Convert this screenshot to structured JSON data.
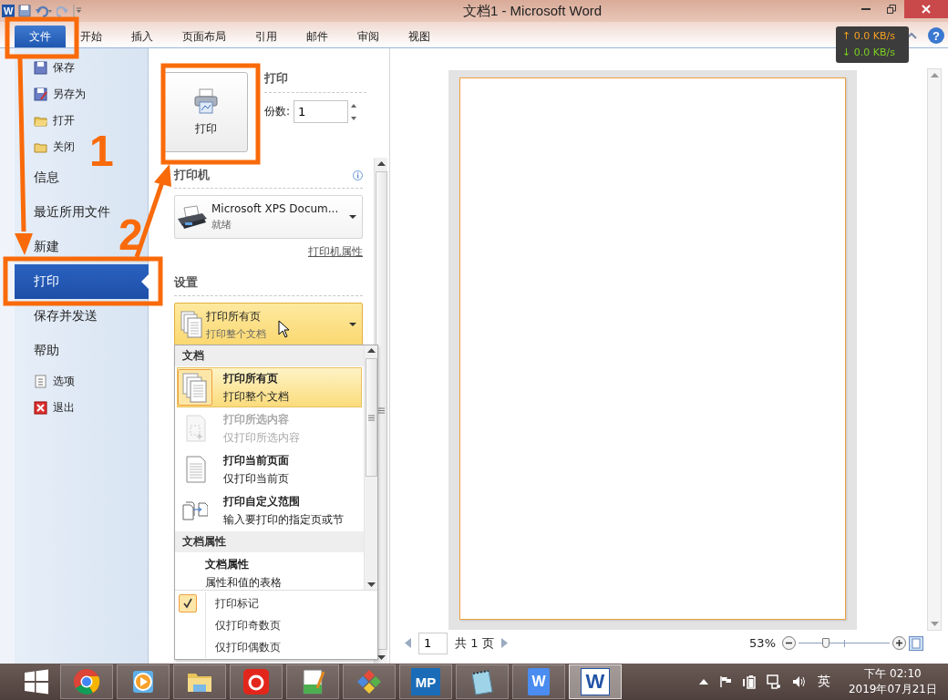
{
  "window": {
    "title": "文档1 - Microsoft Word",
    "app_logo": "W"
  },
  "ribbon_tabs": [
    {
      "label": "文件",
      "selected": true
    },
    {
      "label": "开始",
      "selected": false
    },
    {
      "label": "插入",
      "selected": false
    },
    {
      "label": "页面布局",
      "selected": false
    },
    {
      "label": "引用",
      "selected": false
    },
    {
      "label": "邮件",
      "selected": false
    },
    {
      "label": "审阅",
      "selected": false
    },
    {
      "label": "视图",
      "selected": false
    }
  ],
  "help_button": "?",
  "network_monitor": {
    "upload": "↑ 0.0 KB/s",
    "download": "↓ 0.0 KB/s"
  },
  "sidebar": {
    "items": [
      {
        "label": "保存",
        "kind": "small",
        "selected": false
      },
      {
        "label": "另存为",
        "kind": "small",
        "selected": false
      },
      {
        "label": "打开",
        "kind": "small",
        "selected": false
      },
      {
        "label": "关闭",
        "kind": "small",
        "selected": false
      },
      {
        "label": "信息",
        "kind": "large",
        "selected": false
      },
      {
        "label": "最近所用文件",
        "kind": "large",
        "selected": false
      },
      {
        "label": "新建",
        "kind": "large",
        "selected": false
      },
      {
        "label": "打印",
        "kind": "large",
        "selected": true
      },
      {
        "label": "保存并发送",
        "kind": "large",
        "selected": false
      },
      {
        "label": "帮助",
        "kind": "large",
        "selected": false
      },
      {
        "label": "选项",
        "kind": "small",
        "selected": false
      },
      {
        "label": "退出",
        "kind": "small",
        "selected": false
      }
    ]
  },
  "print_panel": {
    "print_button": "打印",
    "heading": "打印",
    "copies_label": "份数:",
    "copies_value": "1",
    "printer_heading": "打印机",
    "printer": {
      "name": "Microsoft XPS Docum...",
      "status": "就绪"
    },
    "printer_properties_link": "打印机属性",
    "settings_heading": "设置",
    "pages_dropdown": {
      "title": "打印所有页",
      "subtitle": "打印整个文档"
    }
  },
  "pages_menu": {
    "sections": [
      {
        "header": "文档",
        "items": [
          {
            "title": "打印所有页",
            "subtitle": "打印整个文档",
            "selected": true,
            "disabled": false
          },
          {
            "title": "打印所选内容",
            "subtitle": "仅打印所选内容",
            "selected": false,
            "disabled": true
          },
          {
            "title": "打印当前页面",
            "subtitle": "仅打印当前页",
            "selected": false,
            "disabled": false
          },
          {
            "title": "打印自定义范围",
            "subtitle": "输入要打印的指定页或节",
            "selected": false,
            "disabled": false
          }
        ]
      },
      {
        "header": "文档属性",
        "items": [
          {
            "title": "文档属性",
            "subtitle": "属性和值的表格",
            "selected": false,
            "disabled": false
          }
        ]
      }
    ],
    "options": [
      {
        "label": "打印标记",
        "checked": true
      },
      {
        "label": "仅打印奇数页",
        "checked": false
      },
      {
        "label": "仅打印偶数页",
        "checked": false
      }
    ]
  },
  "preview": {
    "page_value": "1",
    "page_total": "共 1 页",
    "zoom": "53%",
    "zoom_slider": {
      "level": 0.3
    }
  },
  "taskbar": {
    "apps": [
      {
        "selected": false
      },
      {
        "selected": false
      },
      {
        "selected": false
      },
      {
        "selected": false
      },
      {
        "selected": false
      },
      {
        "selected": false
      },
      {
        "selected": false,
        "logo_text": "MP"
      },
      {
        "selected": false
      },
      {
        "selected": false,
        "logo_text": "W"
      },
      {
        "selected": true,
        "logo_text": "W"
      }
    ],
    "tray": {
      "ime": "英",
      "time": "下午 02:10",
      "date": "2019年07月21日"
    }
  },
  "annotations": {
    "step_labels": [
      "1",
      "2"
    ]
  }
}
